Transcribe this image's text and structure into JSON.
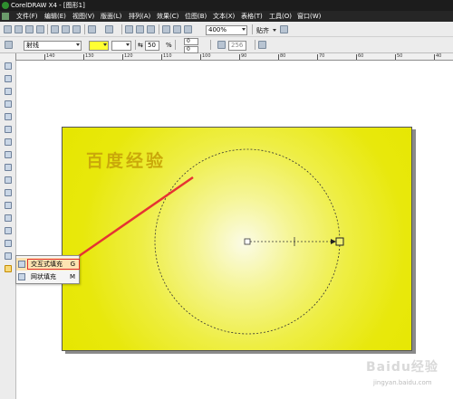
{
  "window": {
    "title": "CorelDRAW X4 - [图形1]"
  },
  "menu": {
    "items": [
      "文件(F)",
      "编辑(E)",
      "视图(V)",
      "版面(L)",
      "排列(A)",
      "效果(C)",
      "位图(B)",
      "文本(X)",
      "表格(T)",
      "工具(O)",
      "窗口(W)"
    ]
  },
  "standard_toolbar": {
    "zoom": "400%",
    "snap_label": "贴齐"
  },
  "property_bar": {
    "fill_type": "射线",
    "midpoint_value": "50",
    "percent_symbol": "%",
    "angle_value": "0",
    "padding_value": "0",
    "steps_value": "256"
  },
  "ruler": {
    "horizontal_labels": [
      "140",
      "130",
      "120",
      "110",
      "100",
      "90",
      "80",
      "70",
      "60",
      "50",
      "40"
    ],
    "vertical_labels": [
      "100",
      "110",
      "120",
      "130",
      "140",
      "150",
      "160",
      "170",
      "180",
      "190",
      "200",
      "210"
    ]
  },
  "canvas": {
    "watermark_text": "百度经验"
  },
  "context_menu": {
    "items": [
      {
        "label": "交互式填充",
        "shortcut": "G"
      },
      {
        "label": "网状填充",
        "shortcut": "M"
      }
    ]
  },
  "logo": {
    "text": "Baidu经验",
    "subtext": "jingyan.baidu.com"
  },
  "colors": {
    "page_fill": "#e6e600",
    "page_center": "#fbfbe6",
    "arrow": "#e53333",
    "titlebar": "#1c1c1c"
  }
}
